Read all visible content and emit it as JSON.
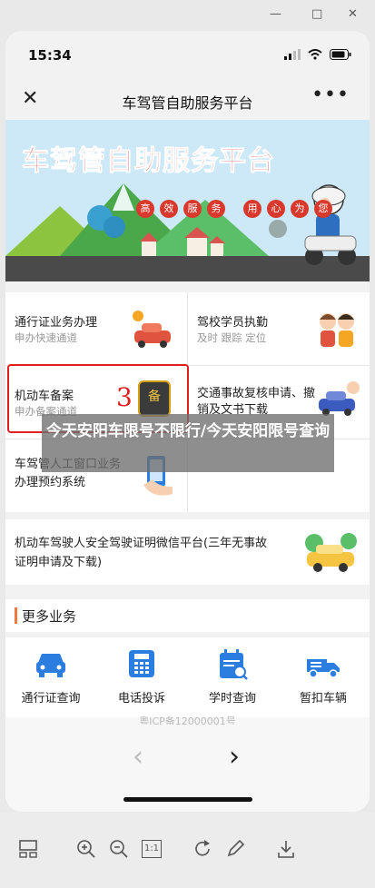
{
  "window": {
    "minimize": "—",
    "maximize": "□",
    "close": "✕"
  },
  "status": {
    "time": "15:34"
  },
  "nav": {
    "title": "车驾管自助服务平台",
    "close": "✕",
    "more": "•••"
  },
  "banner": {
    "title": "车驾管自助服务平台",
    "slogan": [
      "高",
      "效",
      "服",
      "务",
      "用",
      "心",
      "为",
      "您"
    ]
  },
  "grid": [
    {
      "title": "通行证业务办理",
      "sub": "申办快速通道"
    },
    {
      "title": "驾校学员执勤",
      "sub": "及时 跟踪 定位"
    },
    {
      "title": "机动车备案",
      "sub": "申办备案通道"
    },
    {
      "title": "交通事故复核申请、撤销及文书下载",
      "sub": ""
    },
    {
      "title": "车驾管人工窗口业务办理预约系统",
      "sub": ""
    }
  ],
  "annotation": {
    "number": "3",
    "badge": "备"
  },
  "wide_item": {
    "title": "机动车驾驶人安全驾驶证明微信平台(三年无事故证明申请及下载)"
  },
  "more": {
    "heading": "更多业务",
    "items": [
      "通行证查询",
      "电话投诉",
      "学时查询",
      "暂扣车辆"
    ]
  },
  "footer": {
    "partial": "粤ICP备12000001号"
  },
  "overlay": {
    "text": "今天安阳车限号不限行/今天安阳限号查询"
  },
  "browser": {
    "back": "‹",
    "forward": "›",
    "zoom_label": "1:1"
  },
  "colors": {
    "accent_blue": "#2b7de0",
    "annotation_red": "#e02020"
  }
}
